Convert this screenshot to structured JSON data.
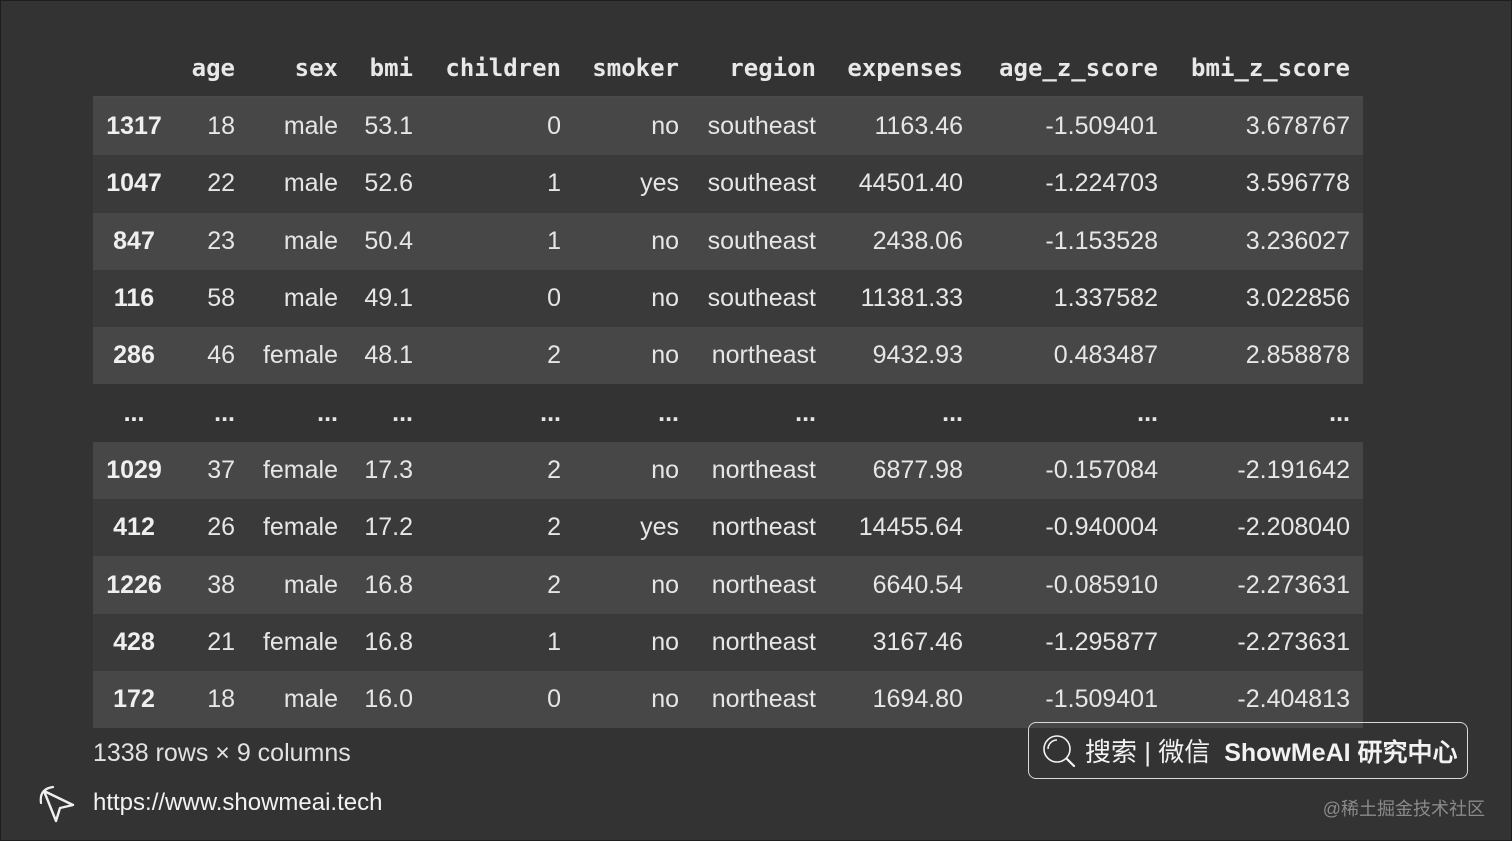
{
  "table": {
    "columns": [
      "age",
      "sex",
      "bmi",
      "children",
      "smoker",
      "region",
      "expenses",
      "age_z_score",
      "bmi_z_score"
    ],
    "rows": [
      {
        "index": "1317",
        "cells": [
          "18",
          "male",
          "53.1",
          "0",
          "no",
          "southeast",
          "1163.46",
          "-1.509401",
          "3.678767"
        ]
      },
      {
        "index": "1047",
        "cells": [
          "22",
          "male",
          "52.6",
          "1",
          "yes",
          "southeast",
          "44501.40",
          "-1.224703",
          "3.596778"
        ]
      },
      {
        "index": "847",
        "cells": [
          "23",
          "male",
          "50.4",
          "1",
          "no",
          "southeast",
          "2438.06",
          "-1.153528",
          "3.236027"
        ]
      },
      {
        "index": "116",
        "cells": [
          "58",
          "male",
          "49.1",
          "0",
          "no",
          "southeast",
          "11381.33",
          "1.337582",
          "3.022856"
        ]
      },
      {
        "index": "286",
        "cells": [
          "46",
          "female",
          "48.1",
          "2",
          "no",
          "northeast",
          "9432.93",
          "0.483487",
          "2.858878"
        ]
      },
      {
        "index": "...",
        "cells": [
          "...",
          "...",
          "...",
          "...",
          "...",
          "...",
          "...",
          "...",
          "..."
        ]
      },
      {
        "index": "1029",
        "cells": [
          "37",
          "female",
          "17.3",
          "2",
          "no",
          "northeast",
          "6877.98",
          "-0.157084",
          "-2.191642"
        ]
      },
      {
        "index": "412",
        "cells": [
          "26",
          "female",
          "17.2",
          "2",
          "yes",
          "northeast",
          "14455.64",
          "-0.940004",
          "-2.208040"
        ]
      },
      {
        "index": "1226",
        "cells": [
          "38",
          "male",
          "16.8",
          "2",
          "no",
          "northeast",
          "6640.54",
          "-0.085910",
          "-2.273631"
        ]
      },
      {
        "index": "428",
        "cells": [
          "21",
          "female",
          "16.8",
          "1",
          "no",
          "northeast",
          "3167.46",
          "-1.295877",
          "-2.273631"
        ]
      },
      {
        "index": "172",
        "cells": [
          "18",
          "male",
          "16.0",
          "0",
          "no",
          "northeast",
          "1694.80",
          "-1.509401",
          "-2.404813"
        ]
      }
    ]
  },
  "shape_text": "1338 rows × 9 columns",
  "footer": {
    "url": "https://www.showmeai.tech",
    "icon": "cursor-arrow-icon"
  },
  "search_box": {
    "icon": "search-icon",
    "text": "搜索 | 微信",
    "brand": "ShowMeAI 研究中心"
  },
  "watermark": "@稀土掘金技术社区",
  "colors": {
    "background": "#333333",
    "row_odd": "#474747",
    "row_even": "#3a3a3a",
    "text": "#e6e6e6"
  }
}
